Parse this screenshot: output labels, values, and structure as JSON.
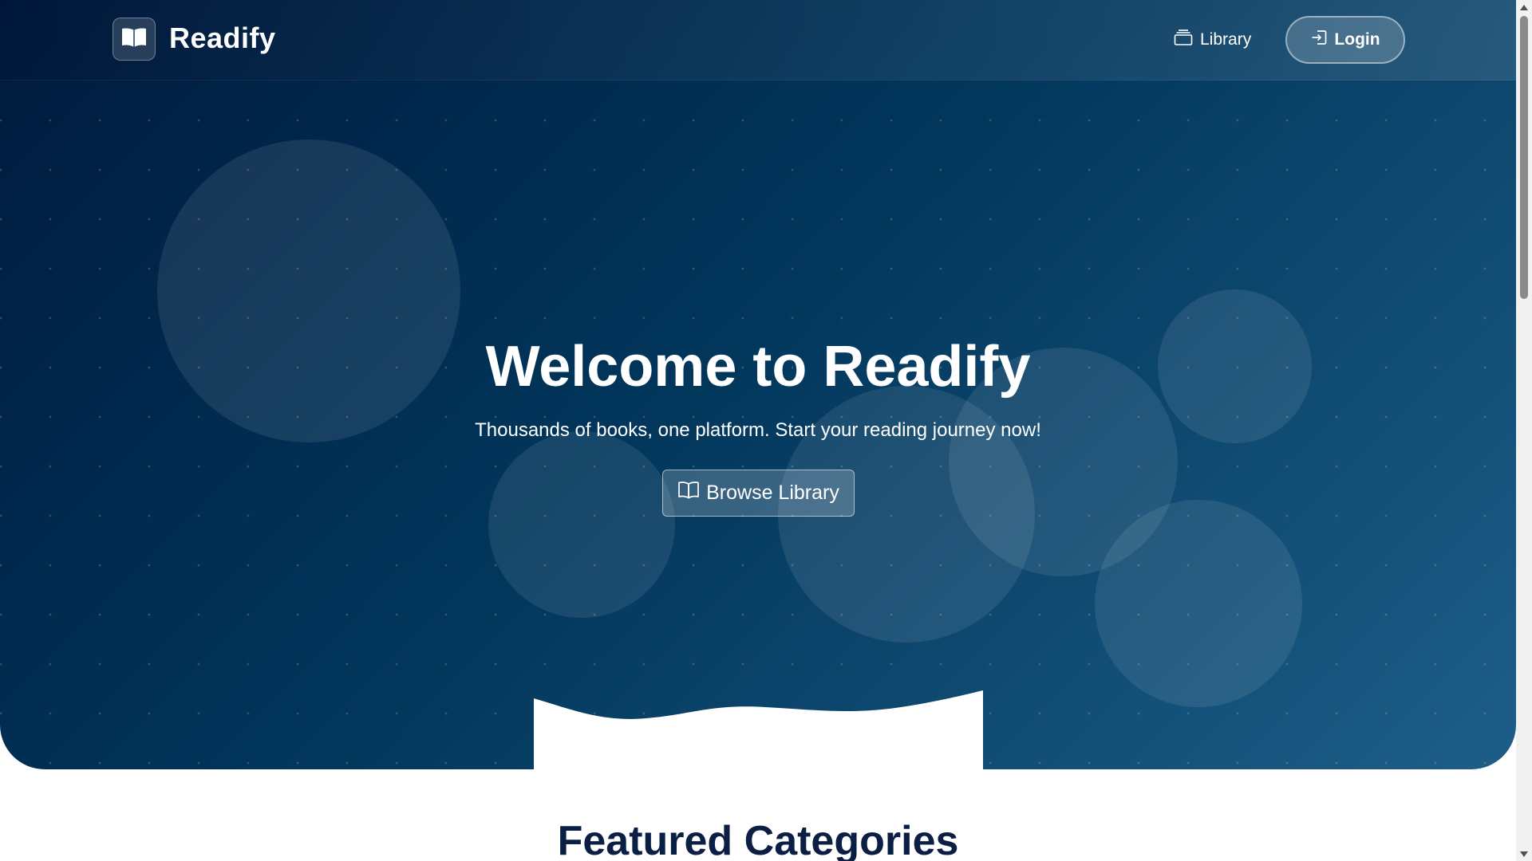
{
  "navbar": {
    "brand": "Readify",
    "logo_icon": "open-book-icon",
    "library_label": "Library",
    "library_icon": "library-stack-icon",
    "login_label": "Login",
    "login_icon": "login-icon"
  },
  "hero": {
    "title": "Welcome to Readify",
    "subtitle": "Thousands of books, one platform. Start your reading journey now!",
    "browse_label": "Browse Library",
    "browse_icon": "open-book-icon"
  },
  "featured": {
    "title": "Featured Categories"
  },
  "colors": {
    "hero_gradient_start": "#001a3d",
    "hero_gradient_mid": "#01355a",
    "hero_gradient_end": "#1d5e88",
    "heading_dark": "#0b1f44",
    "white": "#ffffff"
  }
}
